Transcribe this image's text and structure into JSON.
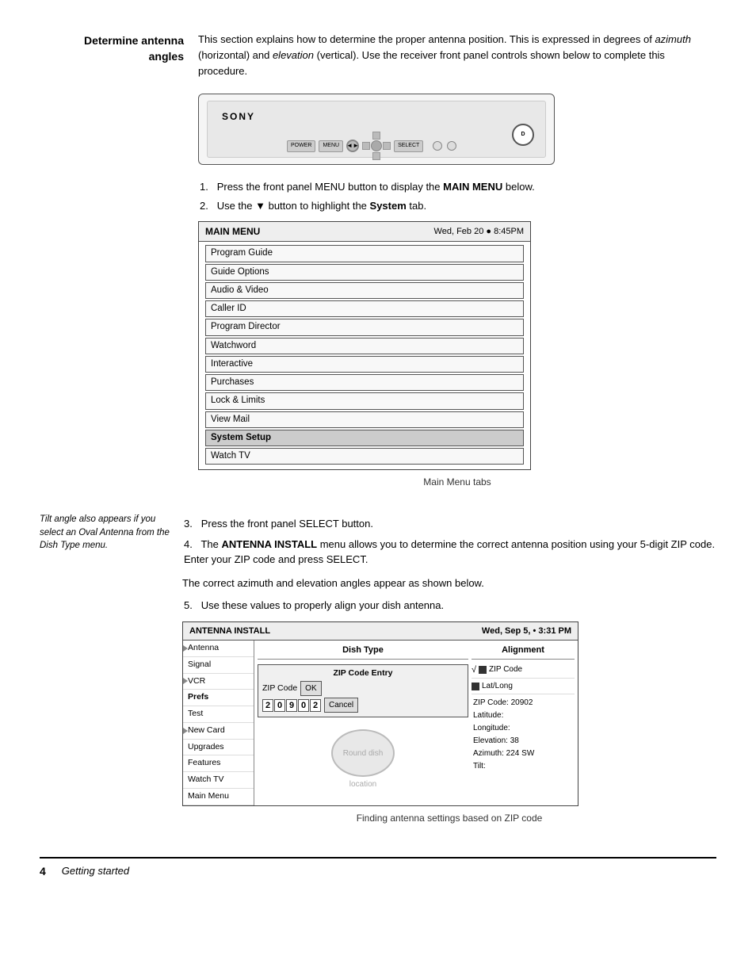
{
  "section": {
    "title_line1": "Determine antenna",
    "title_line2": "angles",
    "intro": "This section explains how to determine the proper antenna position. This is expressed in degrees of",
    "azimuth": "azimuth",
    "horizontal": "(horizontal) and",
    "elevation": "elevation",
    "vertical": "(vertical). Use the receiver front panel controls shown below to complete this procedure."
  },
  "device": {
    "brand": "SONY"
  },
  "steps": [
    {
      "number": "1.",
      "text_before": "Press the front panel MENU button to display the ",
      "bold": "MAIN MENU",
      "text_after": " below."
    },
    {
      "number": "2.",
      "text_before": "Use the ▼ button to highlight the ",
      "bold": "System",
      "text_after": " tab."
    }
  ],
  "main_menu": {
    "title": "MAIN MENU",
    "datetime": "Wed, Feb 20 ● 8:45PM",
    "items": [
      "Program Guide",
      "Guide Options",
      "Audio & Video",
      "Caller ID",
      "Program Director",
      "Watchword",
      "Interactive",
      "Purchases",
      "Lock & Limits",
      "View Mail",
      "System Setup",
      "Watch TV"
    ],
    "caption": "Main Menu tabs"
  },
  "steps2": [
    {
      "number": "3.",
      "text": "Press the front panel SELECT button."
    },
    {
      "number": "4.",
      "text_before": "The ",
      "bold": "ANTENNA INSTALL",
      "text_after": " menu allows you to determine the correct antenna position using your 5-digit ZIP code. Enter your ZIP code and press SELECT."
    }
  ],
  "side_note": "Tilt angle also appears if you select an Oval Antenna from the Dish Type menu.",
  "body_text": "The correct azimuth and elevation angles appear as shown below.",
  "step5": {
    "number": "5.",
    "text": "Use these values to properly align your dish antenna."
  },
  "antenna_install": {
    "title": "ANTENNA INSTALL",
    "datetime": "Wed, Sep 5,  •  3:31 PM",
    "tabs": [
      "Antenna",
      "Signal",
      "VCR",
      "Prefs",
      "Test",
      "New Card",
      "Upgrades",
      "Features",
      "Watch TV",
      "Main Menu"
    ],
    "active_tab": "Prefs",
    "col_dish_head": "Dish Type",
    "col_align_head": "Alignment",
    "zip_entry_label": "ZIP Code Entry",
    "zip_code_label": "ZIP Code",
    "zip_ok": "OK",
    "zip_cancel": "Cancel",
    "zip_digits": [
      "2",
      "0",
      "9",
      "0",
      "2"
    ],
    "zip_checkbox_label": "√",
    "zip_code_text": "ZIP Code",
    "latlong_sq": "■",
    "latlong_label": "Lat/Long",
    "dish_type": "Round dish",
    "location_label": "location",
    "align_data": {
      "zip_code": "ZIP Code: 20902",
      "latitude": "Latitude:",
      "longitude": "Longitude:",
      "elevation": "Elevation:  38",
      "azimuth": "Azimuth:  224 SW",
      "tilt": "Tilt:"
    }
  },
  "antenna_caption": "Finding antenna settings based on ZIP code",
  "footer": {
    "page_number": "4",
    "section_label": "Getting started"
  }
}
